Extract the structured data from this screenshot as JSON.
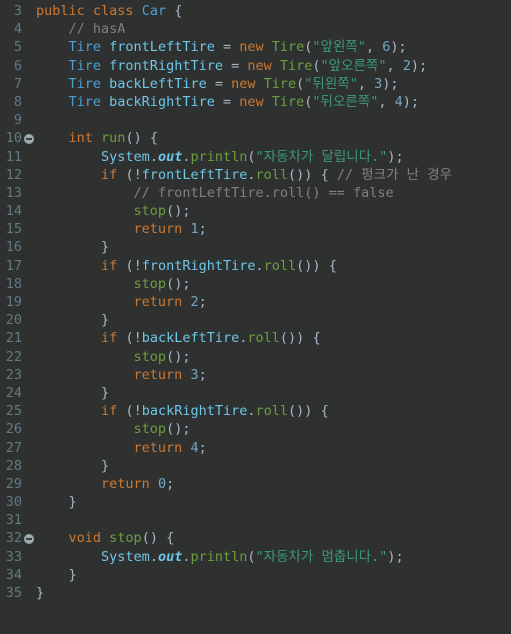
{
  "editor": {
    "name": "java-code-editor",
    "theme": "darcula",
    "background_color": "#2f3130",
    "gutter_color": "#5f7b84",
    "colors": {
      "keyword": "#cc7832",
      "type": "#4e9fd1",
      "variable": "#6ec6e8",
      "method": "#6a9f3f",
      "string": "#3c9a7a",
      "number": "#74a7c4",
      "comment": "#808080",
      "punctuation": "#a9b7c6"
    },
    "first_line_number": 3,
    "last_line_number": 35
  },
  "lines": [
    {
      "number": "3",
      "fold": false,
      "tokens": [
        {
          "t": "public",
          "c": "kw"
        },
        {
          "t": " ",
          "c": "punct"
        },
        {
          "t": "class",
          "c": "kw"
        },
        {
          "t": " ",
          "c": "punct"
        },
        {
          "t": "Car",
          "c": "type"
        },
        {
          "t": " ",
          "c": "punct"
        },
        {
          "t": "{",
          "c": "punct"
        }
      ]
    },
    {
      "number": "4",
      "fold": false,
      "tokens": [
        {
          "t": "    ",
          "c": "punct"
        },
        {
          "t": "// hasA",
          "c": "cmt"
        }
      ]
    },
    {
      "number": "5",
      "fold": false,
      "tokens": [
        {
          "t": "    ",
          "c": "punct"
        },
        {
          "t": "Tire",
          "c": "type"
        },
        {
          "t": " ",
          "c": "punct"
        },
        {
          "t": "frontLeftTire",
          "c": "var"
        },
        {
          "t": " = ",
          "c": "punct"
        },
        {
          "t": "new",
          "c": "kw"
        },
        {
          "t": " ",
          "c": "punct"
        },
        {
          "t": "Tire",
          "c": "method"
        },
        {
          "t": "(",
          "c": "paren"
        },
        {
          "t": "\"앞왼쪽\"",
          "c": "str"
        },
        {
          "t": ", ",
          "c": "punct"
        },
        {
          "t": "6",
          "c": "num"
        },
        {
          "t": ")",
          "c": "paren"
        },
        {
          "t": ";",
          "c": "punct"
        }
      ]
    },
    {
      "number": "6",
      "fold": false,
      "tokens": [
        {
          "t": "    ",
          "c": "punct"
        },
        {
          "t": "Tire",
          "c": "type"
        },
        {
          "t": " ",
          "c": "punct"
        },
        {
          "t": "frontRightTire",
          "c": "var"
        },
        {
          "t": " = ",
          "c": "punct"
        },
        {
          "t": "new",
          "c": "kw"
        },
        {
          "t": " ",
          "c": "punct"
        },
        {
          "t": "Tire",
          "c": "method"
        },
        {
          "t": "(",
          "c": "paren"
        },
        {
          "t": "\"앞오른쪽\"",
          "c": "str"
        },
        {
          "t": ", ",
          "c": "punct"
        },
        {
          "t": "2",
          "c": "num"
        },
        {
          "t": ")",
          "c": "paren"
        },
        {
          "t": ";",
          "c": "punct"
        }
      ]
    },
    {
      "number": "7",
      "fold": false,
      "tokens": [
        {
          "t": "    ",
          "c": "punct"
        },
        {
          "t": "Tire",
          "c": "type"
        },
        {
          "t": " ",
          "c": "punct"
        },
        {
          "t": "backLeftTire",
          "c": "var"
        },
        {
          "t": " = ",
          "c": "punct"
        },
        {
          "t": "new",
          "c": "kw"
        },
        {
          "t": " ",
          "c": "punct"
        },
        {
          "t": "Tire",
          "c": "method"
        },
        {
          "t": "(",
          "c": "paren"
        },
        {
          "t": "\"뒤왼쪽\"",
          "c": "str"
        },
        {
          "t": ", ",
          "c": "punct"
        },
        {
          "t": "3",
          "c": "num"
        },
        {
          "t": ")",
          "c": "paren"
        },
        {
          "t": ";",
          "c": "punct"
        }
      ]
    },
    {
      "number": "8",
      "fold": false,
      "tokens": [
        {
          "t": "    ",
          "c": "punct"
        },
        {
          "t": "Tire",
          "c": "type"
        },
        {
          "t": " ",
          "c": "punct"
        },
        {
          "t": "backRightTire",
          "c": "var"
        },
        {
          "t": " = ",
          "c": "punct"
        },
        {
          "t": "new",
          "c": "kw"
        },
        {
          "t": " ",
          "c": "punct"
        },
        {
          "t": "Tire",
          "c": "method"
        },
        {
          "t": "(",
          "c": "paren"
        },
        {
          "t": "\"뒤오른쪽\"",
          "c": "str"
        },
        {
          "t": ", ",
          "c": "punct"
        },
        {
          "t": "4",
          "c": "num"
        },
        {
          "t": ")",
          "c": "paren"
        },
        {
          "t": ";",
          "c": "punct"
        }
      ]
    },
    {
      "number": "9",
      "fold": false,
      "tokens": []
    },
    {
      "number": "10",
      "fold": true,
      "tokens": [
        {
          "t": "    ",
          "c": "punct"
        },
        {
          "t": "int",
          "c": "kw"
        },
        {
          "t": " ",
          "c": "punct"
        },
        {
          "t": "run",
          "c": "method"
        },
        {
          "t": "()",
          "c": "paren"
        },
        {
          "t": " ",
          "c": "punct"
        },
        {
          "t": "{",
          "c": "punct"
        }
      ]
    },
    {
      "number": "11",
      "fold": false,
      "tokens": [
        {
          "t": "        ",
          "c": "punct"
        },
        {
          "t": "System",
          "c": "var"
        },
        {
          "t": ".",
          "c": "punct"
        },
        {
          "t": "out",
          "c": "stat"
        },
        {
          "t": ".",
          "c": "punct"
        },
        {
          "t": "println",
          "c": "method"
        },
        {
          "t": "(",
          "c": "paren"
        },
        {
          "t": "\"자동차가 달립니다.\"",
          "c": "str"
        },
        {
          "t": ")",
          "c": "paren"
        },
        {
          "t": ";",
          "c": "punct"
        }
      ]
    },
    {
      "number": "12",
      "fold": false,
      "tokens": [
        {
          "t": "        ",
          "c": "punct"
        },
        {
          "t": "if",
          "c": "kw"
        },
        {
          "t": " ",
          "c": "punct"
        },
        {
          "t": "(",
          "c": "paren"
        },
        {
          "t": "!",
          "c": "punct"
        },
        {
          "t": "frontLeftTire",
          "c": "var"
        },
        {
          "t": ".",
          "c": "punct"
        },
        {
          "t": "roll",
          "c": "method"
        },
        {
          "t": "())",
          "c": "paren"
        },
        {
          "t": " ",
          "c": "punct"
        },
        {
          "t": "{",
          "c": "punct"
        },
        {
          "t": " ",
          "c": "punct"
        },
        {
          "t": "// 펑크가 난 경우",
          "c": "cmt"
        }
      ]
    },
    {
      "number": "13",
      "fold": false,
      "tokens": [
        {
          "t": "            ",
          "c": "punct"
        },
        {
          "t": "// frontLeftTire.roll() == false",
          "c": "cmt"
        }
      ]
    },
    {
      "number": "14",
      "fold": false,
      "tokens": [
        {
          "t": "            ",
          "c": "punct"
        },
        {
          "t": "stop",
          "c": "method"
        },
        {
          "t": "()",
          "c": "paren"
        },
        {
          "t": ";",
          "c": "punct"
        }
      ]
    },
    {
      "number": "15",
      "fold": false,
      "tokens": [
        {
          "t": "            ",
          "c": "punct"
        },
        {
          "t": "return",
          "c": "kw"
        },
        {
          "t": " ",
          "c": "punct"
        },
        {
          "t": "1",
          "c": "num"
        },
        {
          "t": ";",
          "c": "punct"
        }
      ]
    },
    {
      "number": "16",
      "fold": false,
      "tokens": [
        {
          "t": "        ",
          "c": "punct"
        },
        {
          "t": "}",
          "c": "punct"
        }
      ]
    },
    {
      "number": "17",
      "fold": false,
      "tokens": [
        {
          "t": "        ",
          "c": "punct"
        },
        {
          "t": "if",
          "c": "kw"
        },
        {
          "t": " ",
          "c": "punct"
        },
        {
          "t": "(",
          "c": "paren"
        },
        {
          "t": "!",
          "c": "punct"
        },
        {
          "t": "frontRightTire",
          "c": "var"
        },
        {
          "t": ".",
          "c": "punct"
        },
        {
          "t": "roll",
          "c": "method"
        },
        {
          "t": "())",
          "c": "paren"
        },
        {
          "t": " ",
          "c": "punct"
        },
        {
          "t": "{",
          "c": "punct"
        }
      ]
    },
    {
      "number": "18",
      "fold": false,
      "tokens": [
        {
          "t": "            ",
          "c": "punct"
        },
        {
          "t": "stop",
          "c": "method"
        },
        {
          "t": "()",
          "c": "paren"
        },
        {
          "t": ";",
          "c": "punct"
        }
      ]
    },
    {
      "number": "19",
      "fold": false,
      "tokens": [
        {
          "t": "            ",
          "c": "punct"
        },
        {
          "t": "return",
          "c": "kw"
        },
        {
          "t": " ",
          "c": "punct"
        },
        {
          "t": "2",
          "c": "num"
        },
        {
          "t": ";",
          "c": "punct"
        }
      ]
    },
    {
      "number": "20",
      "fold": false,
      "tokens": [
        {
          "t": "        ",
          "c": "punct"
        },
        {
          "t": "}",
          "c": "punct"
        }
      ]
    },
    {
      "number": "21",
      "fold": false,
      "tokens": [
        {
          "t": "        ",
          "c": "punct"
        },
        {
          "t": "if",
          "c": "kw"
        },
        {
          "t": " ",
          "c": "punct"
        },
        {
          "t": "(",
          "c": "paren"
        },
        {
          "t": "!",
          "c": "punct"
        },
        {
          "t": "backLeftTire",
          "c": "var"
        },
        {
          "t": ".",
          "c": "punct"
        },
        {
          "t": "roll",
          "c": "method"
        },
        {
          "t": "())",
          "c": "paren"
        },
        {
          "t": " ",
          "c": "punct"
        },
        {
          "t": "{",
          "c": "punct"
        }
      ]
    },
    {
      "number": "22",
      "fold": false,
      "tokens": [
        {
          "t": "            ",
          "c": "punct"
        },
        {
          "t": "stop",
          "c": "method"
        },
        {
          "t": "()",
          "c": "paren"
        },
        {
          "t": ";",
          "c": "punct"
        }
      ]
    },
    {
      "number": "23",
      "fold": false,
      "tokens": [
        {
          "t": "            ",
          "c": "punct"
        },
        {
          "t": "return",
          "c": "kw"
        },
        {
          "t": " ",
          "c": "punct"
        },
        {
          "t": "3",
          "c": "num"
        },
        {
          "t": ";",
          "c": "punct"
        }
      ]
    },
    {
      "number": "24",
      "fold": false,
      "tokens": [
        {
          "t": "        ",
          "c": "punct"
        },
        {
          "t": "}",
          "c": "punct"
        }
      ]
    },
    {
      "number": "25",
      "fold": false,
      "tokens": [
        {
          "t": "        ",
          "c": "punct"
        },
        {
          "t": "if",
          "c": "kw"
        },
        {
          "t": " ",
          "c": "punct"
        },
        {
          "t": "(",
          "c": "paren"
        },
        {
          "t": "!",
          "c": "punct"
        },
        {
          "t": "backRightTire",
          "c": "var"
        },
        {
          "t": ".",
          "c": "punct"
        },
        {
          "t": "roll",
          "c": "method"
        },
        {
          "t": "())",
          "c": "paren"
        },
        {
          "t": " ",
          "c": "punct"
        },
        {
          "t": "{",
          "c": "punct"
        }
      ]
    },
    {
      "number": "26",
      "fold": false,
      "tokens": [
        {
          "t": "            ",
          "c": "punct"
        },
        {
          "t": "stop",
          "c": "method"
        },
        {
          "t": "()",
          "c": "paren"
        },
        {
          "t": ";",
          "c": "punct"
        }
      ]
    },
    {
      "number": "27",
      "fold": false,
      "tokens": [
        {
          "t": "            ",
          "c": "punct"
        },
        {
          "t": "return",
          "c": "kw"
        },
        {
          "t": " ",
          "c": "punct"
        },
        {
          "t": "4",
          "c": "num"
        },
        {
          "t": ";",
          "c": "punct"
        }
      ]
    },
    {
      "number": "28",
      "fold": false,
      "tokens": [
        {
          "t": "        ",
          "c": "punct"
        },
        {
          "t": "}",
          "c": "punct"
        }
      ]
    },
    {
      "number": "29",
      "fold": false,
      "tokens": [
        {
          "t": "        ",
          "c": "punct"
        },
        {
          "t": "return",
          "c": "kw"
        },
        {
          "t": " ",
          "c": "punct"
        },
        {
          "t": "0",
          "c": "num"
        },
        {
          "t": ";",
          "c": "punct"
        }
      ]
    },
    {
      "number": "30",
      "fold": false,
      "tokens": [
        {
          "t": "    ",
          "c": "punct"
        },
        {
          "t": "}",
          "c": "punct"
        }
      ]
    },
    {
      "number": "31",
      "fold": false,
      "tokens": []
    },
    {
      "number": "32",
      "fold": true,
      "tokens": [
        {
          "t": "    ",
          "c": "punct"
        },
        {
          "t": "void",
          "c": "kw"
        },
        {
          "t": " ",
          "c": "punct"
        },
        {
          "t": "stop",
          "c": "method"
        },
        {
          "t": "()",
          "c": "paren"
        },
        {
          "t": " ",
          "c": "punct"
        },
        {
          "t": "{",
          "c": "punct"
        }
      ]
    },
    {
      "number": "33",
      "fold": false,
      "tokens": [
        {
          "t": "        ",
          "c": "punct"
        },
        {
          "t": "System",
          "c": "var"
        },
        {
          "t": ".",
          "c": "punct"
        },
        {
          "t": "out",
          "c": "stat"
        },
        {
          "t": ".",
          "c": "punct"
        },
        {
          "t": "println",
          "c": "method"
        },
        {
          "t": "(",
          "c": "paren"
        },
        {
          "t": "\"자동차가 멈춥니다.\"",
          "c": "str"
        },
        {
          "t": ")",
          "c": "paren"
        },
        {
          "t": ";",
          "c": "punct"
        }
      ]
    },
    {
      "number": "34",
      "fold": false,
      "tokens": [
        {
          "t": "    ",
          "c": "punct"
        },
        {
          "t": "}",
          "c": "punct"
        }
      ]
    },
    {
      "number": "35",
      "fold": false,
      "tokens": [
        {
          "t": "}",
          "c": "punct"
        }
      ]
    }
  ]
}
